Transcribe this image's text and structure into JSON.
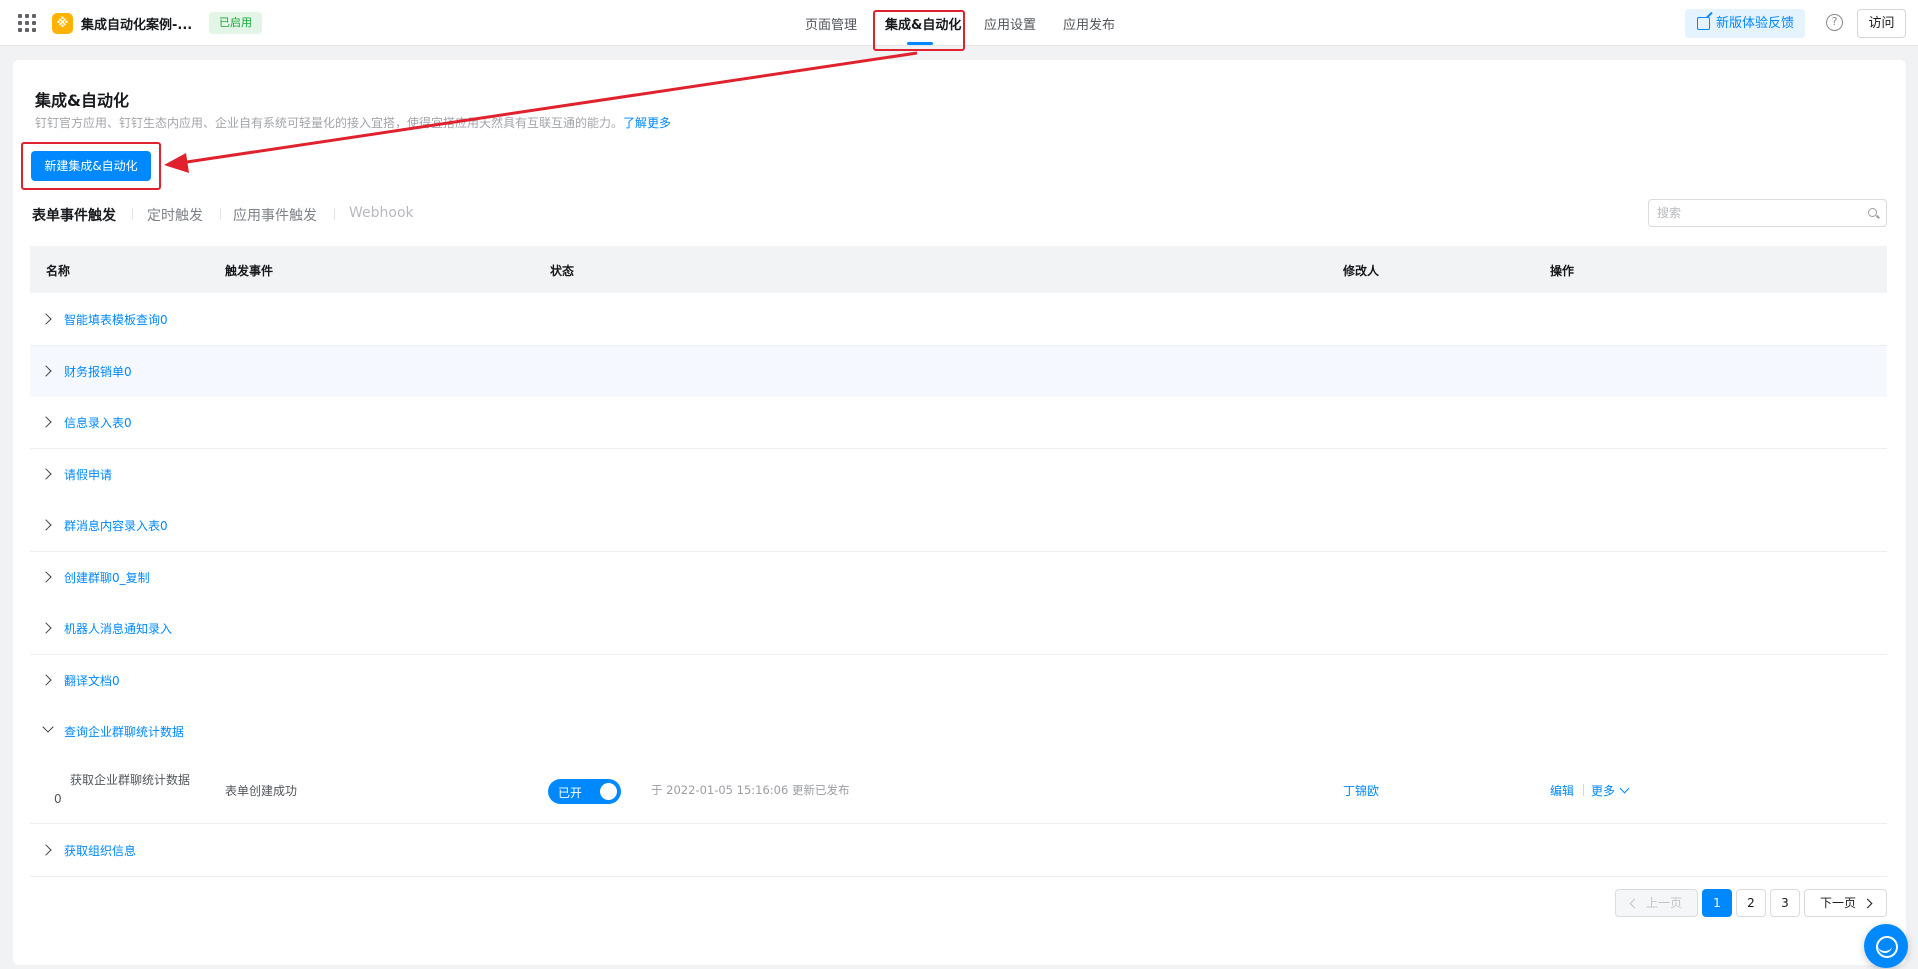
{
  "topbar": {
    "app_name": "集成自动化案例-...",
    "app_logo_glyph": "※",
    "status": "已启用",
    "nav": [
      {
        "label": "页面管理",
        "active": false
      },
      {
        "label": "集成&自动化",
        "active": true
      },
      {
        "label": "应用设置",
        "active": false
      },
      {
        "label": "应用发布",
        "active": false
      }
    ],
    "feedback_label": "新版体验反馈",
    "help_glyph": "?",
    "visit_label": "访问"
  },
  "page": {
    "title": "集成&自动化",
    "description": "钉钉官方应用、钉钉生态内应用、企业自有系统可轻量化的接入宜搭，使得宜搭应用天然具有互联互通的能力。",
    "learn_more": "了解更多",
    "create_button": "新建集成&自动化"
  },
  "sub_tabs": [
    {
      "label": "表单事件触发",
      "state": "active"
    },
    {
      "label": "定时触发",
      "state": "normal"
    },
    {
      "label": "应用事件触发",
      "state": "normal"
    },
    {
      "label": "Webhook",
      "state": "muted"
    }
  ],
  "search": {
    "placeholder": "搜索"
  },
  "table": {
    "headers": {
      "name": "名称",
      "trigger": "触发事件",
      "status": "状态",
      "modifier": "修改人",
      "operation": "操作"
    },
    "groups": [
      {
        "name": "智能填表模板查询0",
        "expanded": false
      },
      {
        "name": "财务报销单0",
        "expanded": false
      },
      {
        "name": "信息录入表0",
        "expanded": false
      },
      {
        "name": "请假申请",
        "expanded": false
      },
      {
        "name": "群消息内容录入表0",
        "expanded": false
      },
      {
        "name": "创建群聊0_复制",
        "expanded": false
      },
      {
        "name": "机器人消息通知录入",
        "expanded": false
      },
      {
        "name": "翻译文档0",
        "expanded": false
      },
      {
        "name": "查询企业群聊统计数据",
        "expanded": true
      },
      {
        "name": "获取组织信息",
        "expanded": false
      }
    ],
    "detail": {
      "name_line1": "获取企业群聊统计数据",
      "name_line2": "0",
      "trigger": "表单创建成功",
      "toggle_label": "已开",
      "toggle_on": true,
      "update_text": "于 2022-01-05 15:16:06 更新已发布",
      "modifier": "丁锦欧",
      "edit_label": "编辑",
      "more_label": "更多"
    }
  },
  "pagination": {
    "prev_label": "上一页",
    "pages": [
      "1",
      "2",
      "3"
    ],
    "current": "1",
    "next_label": "下一页"
  },
  "colors": {
    "accent": "#0089ff",
    "annotation": "#e0222e",
    "status_green": "#15a73b"
  }
}
